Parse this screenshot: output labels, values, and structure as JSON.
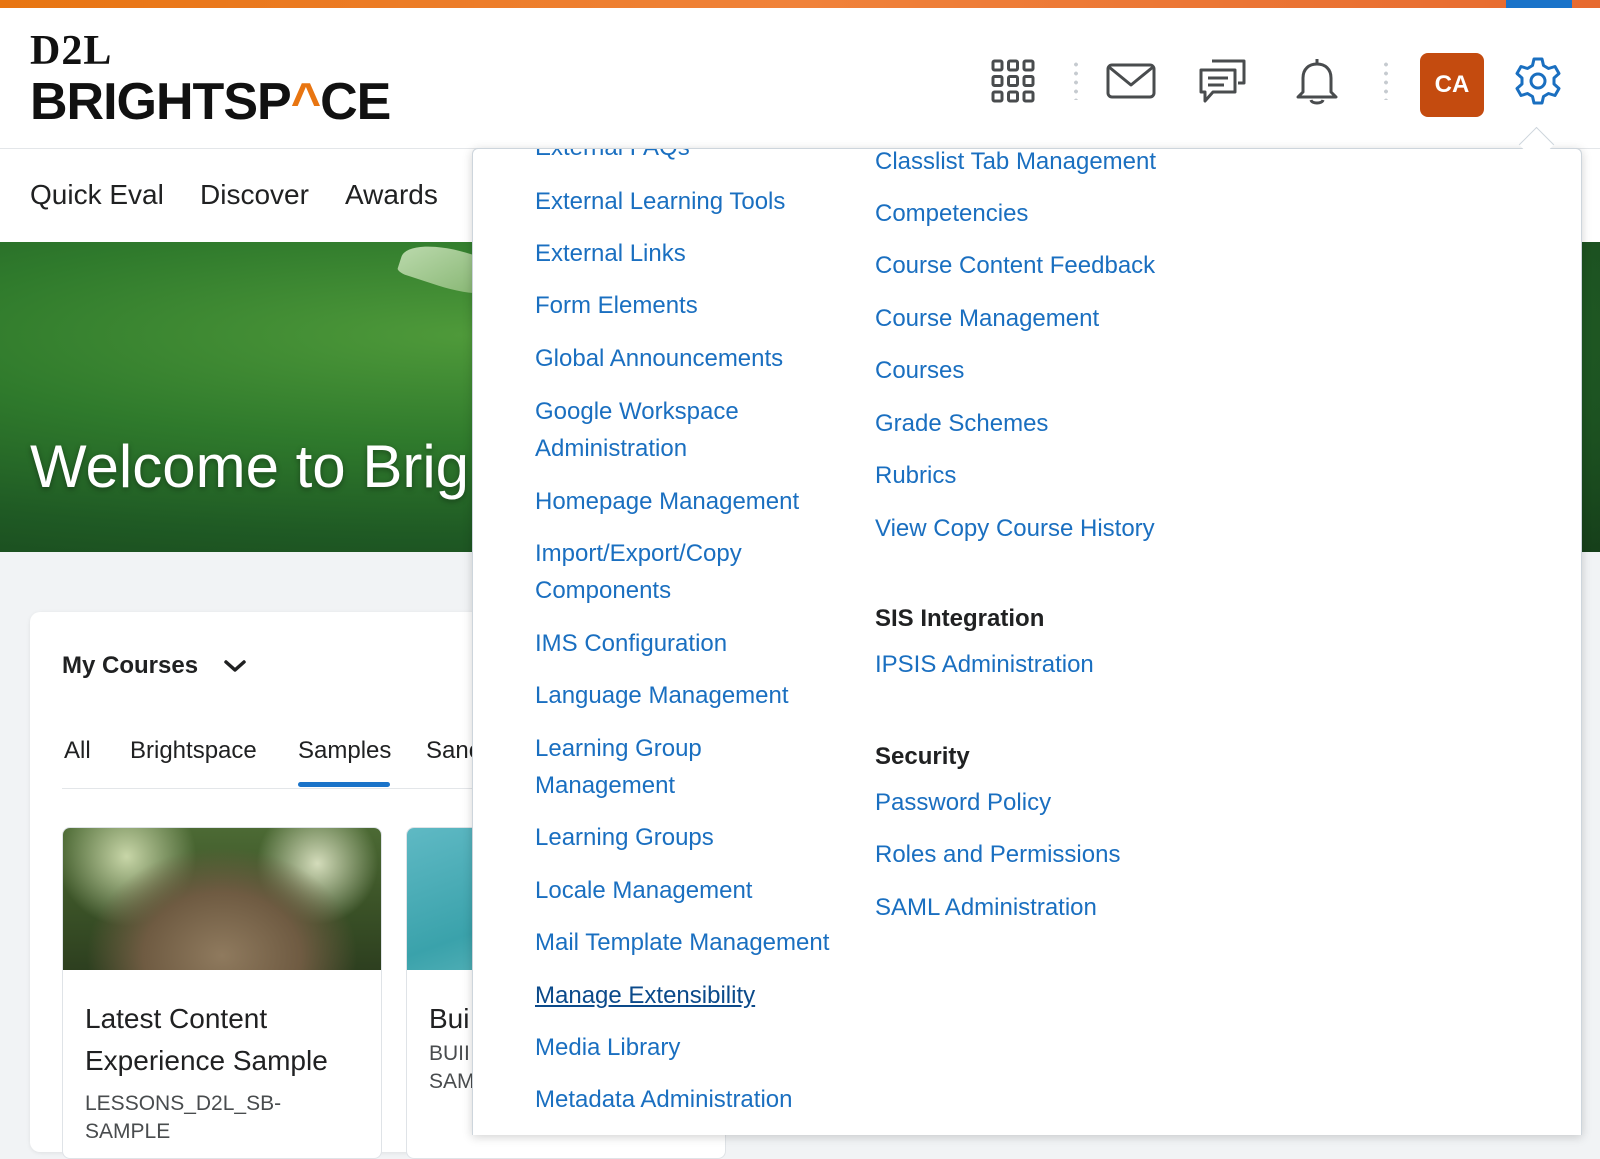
{
  "header": {
    "logo_top": "D2L",
    "logo_bottom_left": "BRIGHTSP",
    "logo_bottom_mark": "^",
    "logo_bottom_right": "CE",
    "avatar_initials": "CA",
    "icons": [
      "apps-grid-icon",
      "mail-icon",
      "chat-icon",
      "bell-icon",
      "gear-icon"
    ]
  },
  "nav": {
    "items": [
      "Quick Eval",
      "Discover",
      "Awards"
    ]
  },
  "banner": {
    "title": "Welcome to Brig"
  },
  "my_courses": {
    "title": "My Courses",
    "tabs": [
      "All",
      "Brightspace",
      "Samples",
      "Sanc"
    ],
    "active_tab": "Samples",
    "cards": [
      {
        "title_line1": "Latest Content",
        "title_line2": "Experience Sample",
        "sub_line1": "LESSONS_D2L_SB-",
        "sub_line2": "SAMPLE"
      },
      {
        "title_line1": "Bui",
        "sub_line1": "BUII",
        "sub_line2": "SAM"
      }
    ]
  },
  "admin_menu": {
    "col1": {
      "partial_top": "External FAQs",
      "links": [
        "External Learning Tools",
        "External Links",
        "Form Elements",
        "Global Announcements",
        "Google Workspace",
        "Administration",
        "Homepage Management",
        "Import/Export/Copy",
        "Components",
        "IMS Configuration",
        "Language Management",
        "Learning Group",
        "Management",
        "Learning Groups",
        "Locale Management",
        "Mail Template Management",
        "Manage Extensibility",
        "Media Library",
        "Metadata Administration"
      ]
    },
    "col2": {
      "partial_top": "Classlist Tab Management",
      "links": [
        "Competencies",
        "Course Content Feedback",
        "Course Management",
        "Courses",
        "Grade Schemes",
        "Rubrics",
        "View Copy Course History"
      ],
      "sis_heading": "SIS Integration",
      "sis_links": [
        "IPSIS Administration"
      ],
      "security_heading": "Security",
      "security_links": [
        "Password Policy",
        "Roles and Permissions",
        "SAML Administration"
      ]
    },
    "hovered_link": "Manage Extensibility",
    "colors": {
      "link": "#1a6fc0",
      "link_hover": "#0b4a8a",
      "accent": "#e87511",
      "avatar": "#c44b0f"
    }
  }
}
